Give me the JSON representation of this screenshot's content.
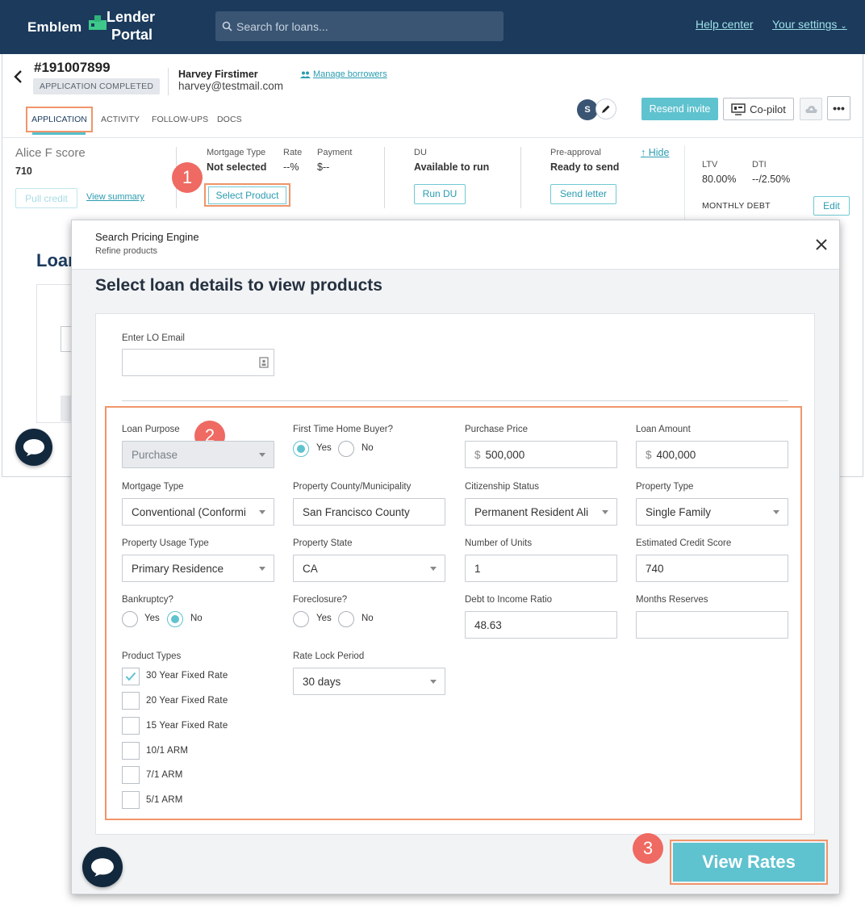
{
  "nav": {
    "brand_left": "Emblem",
    "brand_top": "Lender",
    "brand_bottom": "Portal",
    "search_placeholder": "Search for loans...",
    "help_center": "Help center",
    "your_settings": "Your settings"
  },
  "loan": {
    "id": "#191007899",
    "status": "APPLICATION COMPLETED",
    "borrower_name": "Harvey Firstimer",
    "borrower_email": "harvey@testmail.com",
    "manage_borrowers": "Manage borrowers",
    "tabs": [
      "APPLICATION",
      "ACTIVITY",
      "FOLLOW-UPS",
      "DOCS"
    ],
    "avatar_initial": "S",
    "resend_invite": "Resend invite",
    "copilot": "Co-pilot",
    "more": "•••"
  },
  "summary": {
    "score_title": "Alice F score",
    "score_value": "710",
    "pull_credit": "Pull credit",
    "view_summary": "View summary",
    "mortgage_type_label": "Mortgage Type",
    "mortgage_type_value": "Not selected",
    "rate_label": "Rate",
    "rate_value": "--%",
    "payment_label": "Payment",
    "payment_value": "$--",
    "select_product": "Select Product",
    "du_label": "DU",
    "du_value": "Available to run",
    "run_du": "Run DU",
    "preapproval_label": "Pre-approval",
    "preapproval_value": "Ready to send",
    "send_letter": "Send letter",
    "hide": "Hide",
    "ltv_label": "LTV",
    "ltv_value": "80.00%",
    "dti_label": "DTI",
    "dti_value": "--/2.50%",
    "monthly_debt": "MONTHLY DEBT",
    "edit": "Edit",
    "loan_peek": "Loar"
  },
  "badges": [
    "1",
    "2",
    "3"
  ],
  "modal": {
    "title": "Search Pricing Engine",
    "subtitle": "Refine products",
    "heading": "Select loan details to view products",
    "lo_email_label": "Enter LO Email",
    "lo_email_value": "",
    "fields": {
      "loan_purpose": {
        "label": "Loan Purpose",
        "value": "Purchase"
      },
      "first_time_buyer": {
        "label": "First Time Home Buyer?",
        "yes": "Yes",
        "no": "No",
        "selected": "Yes"
      },
      "purchase_price": {
        "label": "Purchase Price",
        "prefix": "$",
        "value": "500,000"
      },
      "loan_amount": {
        "label": "Loan Amount",
        "prefix": "$",
        "value": "400,000"
      },
      "mortgage_type": {
        "label": "Mortgage Type",
        "value": "Conventional (Conformi"
      },
      "property_county": {
        "label": "Property County/Municipality",
        "value": "San Francisco County"
      },
      "citizenship": {
        "label": "Citizenship Status",
        "value": "Permanent Resident Ali"
      },
      "property_type": {
        "label": "Property Type",
        "value": "Single Family"
      },
      "usage_type": {
        "label": "Property Usage Type",
        "value": "Primary Residence"
      },
      "property_state": {
        "label": "Property State",
        "value": "CA"
      },
      "units": {
        "label": "Number of Units",
        "value": "1"
      },
      "credit_score": {
        "label": "Estimated Credit Score",
        "value": "740"
      },
      "bankruptcy": {
        "label": "Bankruptcy?",
        "yes": "Yes",
        "no": "No",
        "selected": "No"
      },
      "foreclosure": {
        "label": "Foreclosure?",
        "yes": "Yes",
        "no": "No",
        "selected": ""
      },
      "dti": {
        "label": "Debt to Income Ratio",
        "value": "48.63"
      },
      "months_reserves": {
        "label": "Months Reserves",
        "value": ""
      },
      "product_types": {
        "label": "Product Types",
        "items": [
          {
            "label": "30 Year Fixed Rate",
            "checked": true
          },
          {
            "label": "20 Year Fixed Rate",
            "checked": false
          },
          {
            "label": "15 Year Fixed Rate",
            "checked": false
          },
          {
            "label": "10/1 ARM",
            "checked": false
          },
          {
            "label": "7/1 ARM",
            "checked": false
          },
          {
            "label": "5/1 ARM",
            "checked": false
          }
        ]
      },
      "rate_lock": {
        "label": "Rate Lock Period",
        "value": "30 days"
      }
    },
    "view_rates": "View Rates"
  },
  "colors": {
    "nav_bg": "#1b3a5c",
    "accent_teal": "#5fc2cf",
    "highlight_orange": "#f0956a",
    "badge_red": "#ee6a62"
  }
}
